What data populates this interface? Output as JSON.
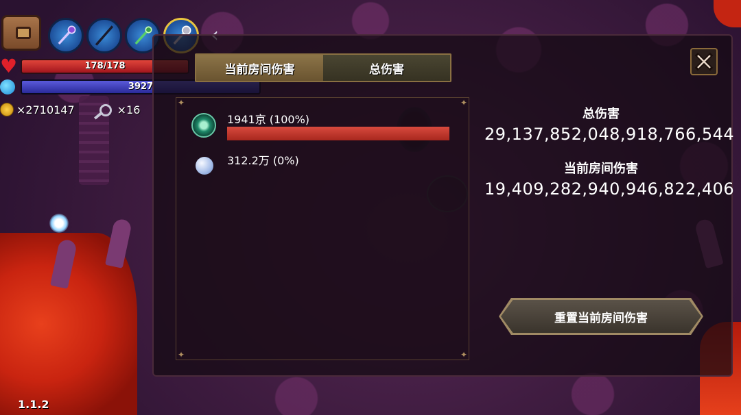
{
  "hud": {
    "hp_text": "178/178",
    "hp_fraction": 1.0,
    "mp_text": "3927",
    "mp_fraction": 1.0,
    "coins": "×2710147",
    "keys": "×16",
    "weapons": [
      "scepter-icon",
      "whip-icon",
      "staff-icon",
      "mace-icon"
    ],
    "selected_weapon_index": 3
  },
  "tabs": {
    "current_room": "当前房间伤害",
    "total": "总伤害",
    "active": "current_room"
  },
  "damage_list": [
    {
      "icon": "emerald-orb-icon",
      "label": "1941京 (100%)",
      "percent": 100
    },
    {
      "icon": "pearl-icon",
      "label": "312.2万 (0%)",
      "percent": 0
    }
  ],
  "stats": {
    "total_label": "总伤害",
    "total_value": "29,137,852,048,918,766,544",
    "room_label": "当前房间伤害",
    "room_value": "19,409,282,940,946,822,406"
  },
  "reset_button": "重置当前房间伤害",
  "version": "1.1.2",
  "colors": {
    "hp": "#c92a2a",
    "mp": "#3f3fbf",
    "damage_bar": "#c63a30",
    "tab_active": "#7c6440",
    "panel_border": "#8a7042"
  }
}
